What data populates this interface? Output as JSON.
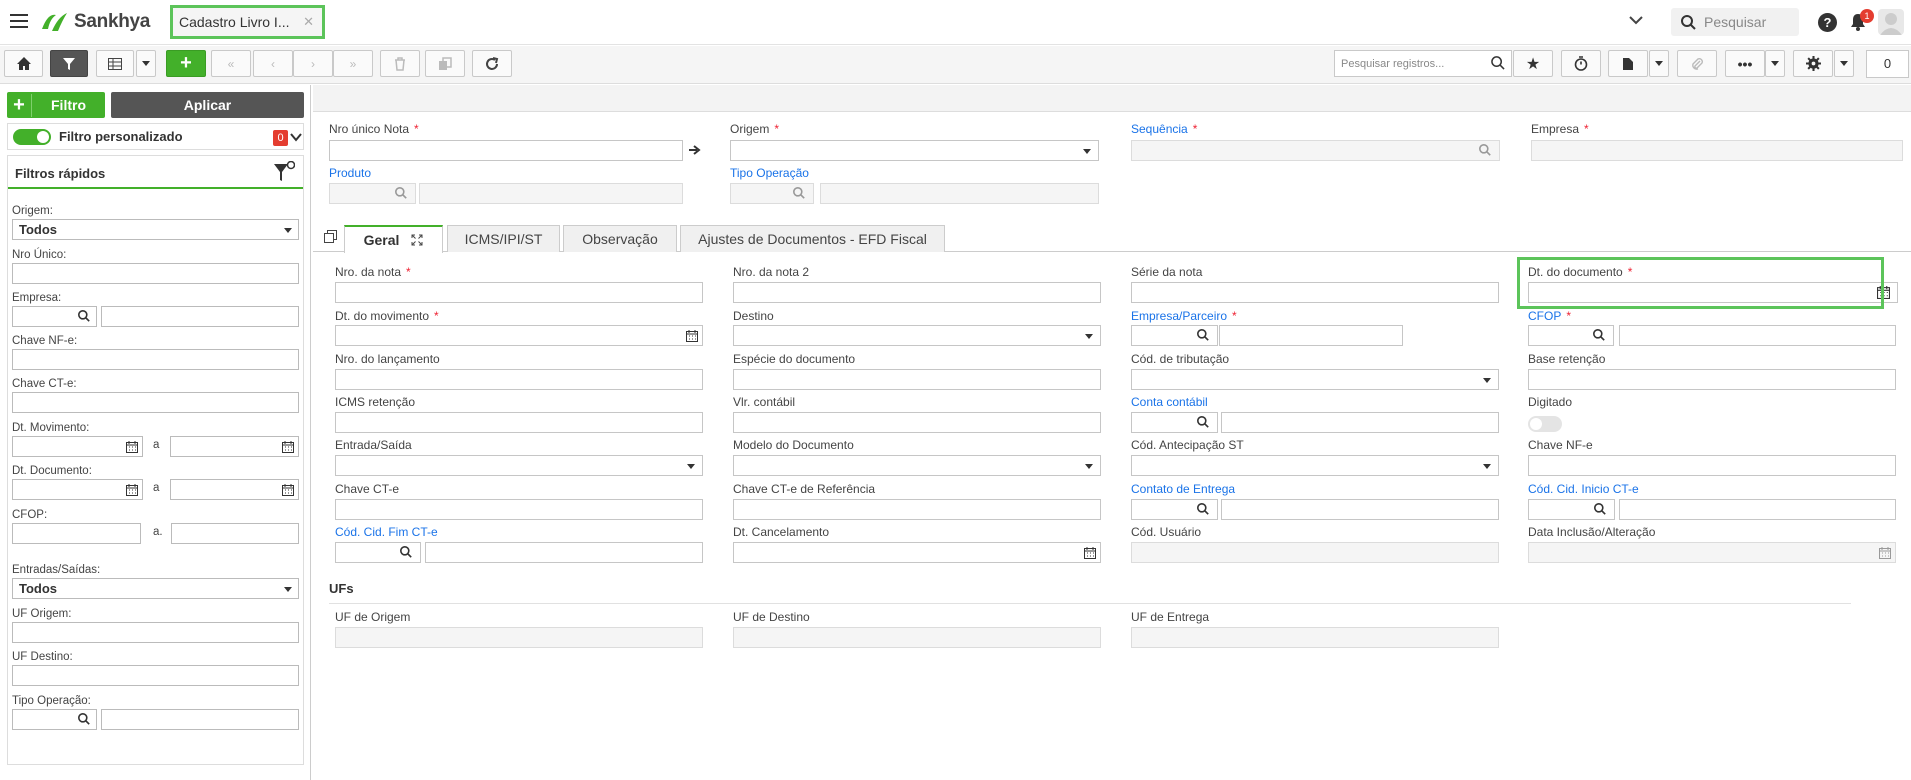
{
  "header": {
    "logo_text": "Sankhya",
    "app_tab_title": "Cadastro Livro I...",
    "search_placeholder": "Pesquisar",
    "notification_count": "1",
    "accent_color": "#43b02a"
  },
  "toolbar": {
    "search_placeholder": "Pesquisar registros...",
    "counter": "0"
  },
  "left": {
    "filter_button": "Filtro",
    "apply_button": "Aplicar",
    "custom_filter_label": "Filtro personalizado",
    "custom_filter_count": "0",
    "quick_filters_title": "Filtros rápidos",
    "fields": {
      "origem_label": "Origem:",
      "origem_value": "Todos",
      "nro_unico_label": "Nro Único:",
      "empresa_label": "Empresa:",
      "chave_nfe_label": "Chave NF-e:",
      "chave_cte_label": "Chave CT-e:",
      "dt_mov_label": "Dt. Movimento:",
      "dt_mov_sep": "a",
      "dt_doc_label": "Dt. Documento:",
      "dt_doc_sep": "a",
      "cfop_label": "CFOP:",
      "cfop_sep": "a.",
      "ent_sai_label": "Entradas/Saídas:",
      "ent_sai_value": "Todos",
      "uf_origem_label": "UF Origem:",
      "uf_destino_label": "UF Destino:",
      "tipo_op_label": "Tipo Operação:"
    }
  },
  "form_top": {
    "nro_unico_nota": "Nro único Nota",
    "origem": "Origem",
    "sequencia": "Sequência",
    "empresa": "Empresa",
    "produto": "Produto",
    "tipo_operacao": "Tipo Operação",
    "required_mark": "*"
  },
  "tabs": [
    "Geral",
    "ICMS/IPI/ST",
    "Observação",
    "Ajustes de Documentos - EFD Fiscal"
  ],
  "geral": {
    "nro_nota": "Nro. da nota",
    "nro_nota2": "Nro. da nota 2",
    "serie_nota": "Série da nota",
    "dt_documento": "Dt. do documento",
    "dt_movimento": "Dt. do movimento",
    "destino": "Destino",
    "empresa_parceiro": "Empresa/Parceiro",
    "cfop": "CFOP",
    "nro_lancamento": "Nro. do lançamento",
    "especie_documento": "Espécie do documento",
    "cod_tributacao": "Cód. de tributação",
    "base_retencao": "Base retenção",
    "icms_retencao": "ICMS retenção",
    "vlr_contabil": "Vlr. contábil",
    "conta_contabil": "Conta contábil",
    "digitado": "Digitado",
    "entrada_saida": "Entrada/Saída",
    "modelo_documento": "Modelo do Documento",
    "cod_antecipacao_st": "Cód. Antecipação ST",
    "chave_nfe": "Chave NF-e",
    "chave_cte": "Chave CT-e",
    "chave_cte_ref": "Chave CT-e de Referência",
    "contato_entrega": "Contato de Entrega",
    "cod_cid_inicio": "Cód. Cid. Inicio CT-e",
    "cod_cid_fim": "Cód. Cid. Fim CT-e",
    "dt_cancelamento": "Dt. Cancelamento",
    "cod_usuario": "Cód. Usuário",
    "data_inclusao": "Data Inclusão/Alteração",
    "ufs_title": "UFs",
    "uf_origem": "UF de Origem",
    "uf_destino": "UF de Destino",
    "uf_entrega": "UF de Entrega"
  }
}
